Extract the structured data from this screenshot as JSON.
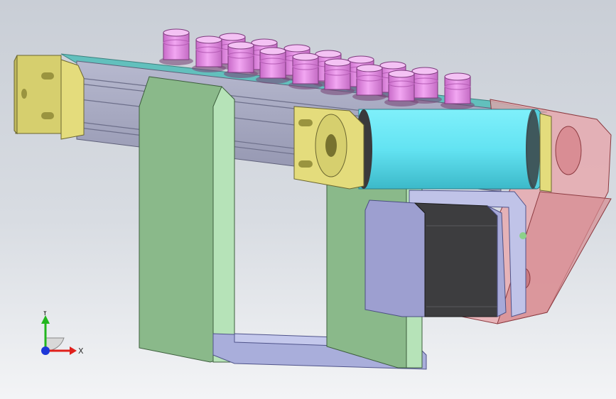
{
  "scene": {
    "background_top": "#c9ced6",
    "background_bottom": "#f3f4f6",
    "part_colors": {
      "end_block": "#e4dc7c",
      "rail": "#a9abc2",
      "belt_top": "#62c0bd",
      "support_green": "#8ab98a",
      "support_light": "#b6e3b8",
      "base_frame": "#a9aedb",
      "roller": "#63e3f2",
      "motor": "#3d3d3f",
      "motor_flange": "#9d9fd0",
      "guard": "#e8a3a8",
      "cup": "#e894e8"
    },
    "part_icons": [
      "end-block-left",
      "end-block-right",
      "conveyor-rail",
      "roller",
      "stepper-motor",
      "guard-plate",
      "support-bracket",
      "cup-array"
    ]
  },
  "triad": {
    "x_label": "X",
    "y_label": "Y",
    "x_color": "#e0201c",
    "y_color": "#22b61e",
    "z_color": "#1d37d8"
  }
}
